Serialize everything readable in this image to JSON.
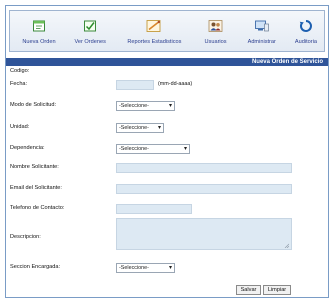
{
  "toolbar": {
    "items": [
      {
        "label": "Nueva Orden"
      },
      {
        "label": "Ver Ordenes"
      },
      {
        "label": "Reportes Estadisticos"
      },
      {
        "label": "Usuarios"
      },
      {
        "label": "Administrar"
      },
      {
        "label": "Auditoria"
      }
    ]
  },
  "form": {
    "title": "Nueva Orden de Servicio",
    "codigo_label": "Codigo:",
    "fecha_label": "Fecha:",
    "fecha_hint": "(mm-dd-aaaa)",
    "modo_label": "Modo de Solicitud:",
    "modo_value": "-Seleccione-",
    "unidad_label": "Unidad:",
    "unidad_value": "-Seleccione-",
    "dependencia_label": "Dependencia:",
    "dependencia_value": "-Seleccione-",
    "nombre_label": "Nombre Solicitante:",
    "email_label": "Email del Solicitante:",
    "telefono_label": "Telefono de Contacto:",
    "descripcion_label": "Descripcion:",
    "seccion_label": "Seccion Encargada:",
    "seccion_value": "-Seleccione-",
    "save_label": "Salvar",
    "clear_label": "Limpiar"
  },
  "colors": {
    "header_bar": "#2f5499",
    "input_fill": "#dde9f3",
    "toolbar_text": "#2b3e8f"
  }
}
